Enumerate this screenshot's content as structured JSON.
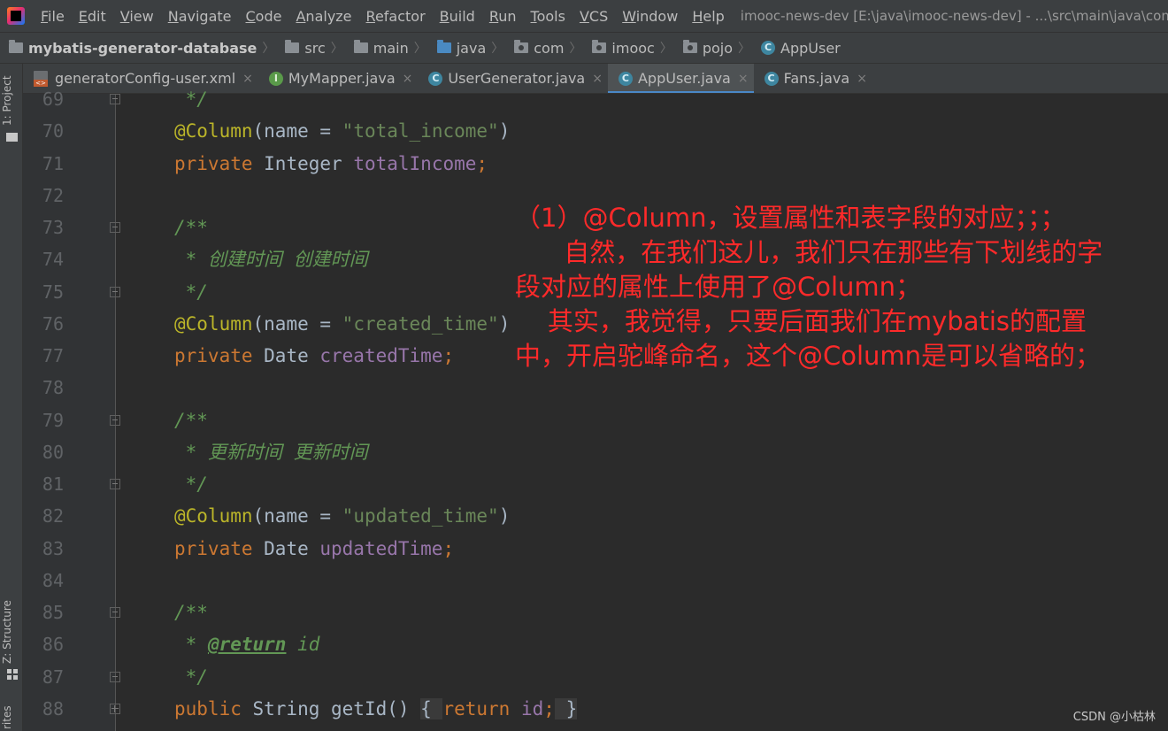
{
  "menubar": {
    "items": [
      "File",
      "Edit",
      "View",
      "Navigate",
      "Code",
      "Analyze",
      "Refactor",
      "Build",
      "Run",
      "Tools",
      "VCS",
      "Window",
      "Help"
    ],
    "window_title": "imooc-news-dev [E:\\java\\imooc-news-dev] - ...\\src\\main\\java\\com\\imoocW"
  },
  "breadcrumb": {
    "project": "mybatis-generator-database",
    "path": [
      "src",
      "main",
      "java",
      "com",
      "imooc",
      "pojo"
    ],
    "file": "AppUser"
  },
  "sidebar": {
    "project_label": "1: Project",
    "structure_label": "Z: Structure",
    "favorites_label": "rites"
  },
  "tabs": [
    {
      "label": "generatorConfig-user.xml",
      "icon": "xml-file-icon",
      "active": false
    },
    {
      "label": "MyMapper.java",
      "icon": "interface-icon",
      "icon_letter": "I",
      "active": false
    },
    {
      "label": "UserGenerator.java",
      "icon": "class-icon",
      "icon_letter": "C",
      "active": false
    },
    {
      "label": "AppUser.java",
      "icon": "class-icon",
      "icon_letter": "C",
      "active": true
    },
    {
      "label": "Fans.java",
      "icon": "class-icon",
      "icon_letter": "C",
      "active": false
    }
  ],
  "tab_close_glyph": "×",
  "code_lines": [
    {
      "num": "69",
      "text": " */"
    },
    {
      "num": "70",
      "text": "@Column(name = \"total_income\")"
    },
    {
      "num": "71",
      "text": "private Integer totalIncome;"
    },
    {
      "num": "72",
      "text": ""
    },
    {
      "num": "73",
      "text": "/**"
    },
    {
      "num": "74",
      "text": " * 创建时间 创建时间"
    },
    {
      "num": "75",
      "text": " */"
    },
    {
      "num": "76",
      "text": "@Column(name = \"created_time\")"
    },
    {
      "num": "77",
      "text": "private Date createdTime;"
    },
    {
      "num": "78",
      "text": ""
    },
    {
      "num": "79",
      "text": "/**"
    },
    {
      "num": "80",
      "text": " * 更新时间 更新时间"
    },
    {
      "num": "81",
      "text": " */"
    },
    {
      "num": "82",
      "text": "@Column(name = \"updated_time\")"
    },
    {
      "num": "83",
      "text": "private Date updatedTime;"
    },
    {
      "num": "84",
      "text": ""
    },
    {
      "num": "85",
      "text": "/**"
    },
    {
      "num": "86",
      "text": " * @return id"
    },
    {
      "num": "87",
      "text": " */"
    },
    {
      "num": "88",
      "text": "public String getId() { return id; }"
    }
  ],
  "annotation_note": {
    "lines": [
      "（1）@Column，设置属性和表字段的对应；；；",
      "      自然，在我们这儿，我们只在那些有下划线的字",
      "段对应的属性上使用了@Column；",
      "    其实，我觉得，只要后面我们在mybatis的配置",
      "中，开启驼峰命名，这个@Column是可以省略的；"
    ],
    "color": "#ff2a2a"
  },
  "watermark": "CSDN @小枯林",
  "colors": {
    "keyword": "#cc7832",
    "annotation": "#bbb529",
    "string": "#6a8759",
    "field": "#9876aa",
    "doc_comment": "#629755",
    "plain": "#a9b7c6",
    "editor_bg": "#2b2b2b",
    "chrome_bg": "#3c3f41"
  }
}
